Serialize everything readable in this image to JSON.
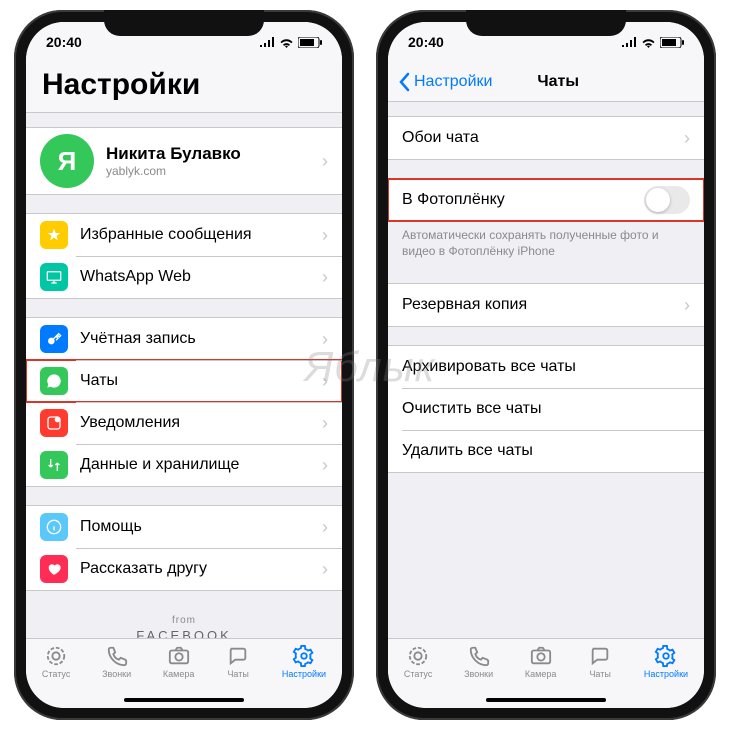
{
  "status": {
    "time": "20:40"
  },
  "left": {
    "title": "Настройки",
    "profile": {
      "initial": "Я",
      "name": "Никита Булавко",
      "sub": "yablyk.com"
    },
    "g1": [
      {
        "label": "Избранные сообщения"
      },
      {
        "label": "WhatsApp Web"
      }
    ],
    "g2": [
      {
        "label": "Учётная запись"
      },
      {
        "label": "Чаты"
      },
      {
        "label": "Уведомления"
      },
      {
        "label": "Данные и хранилище"
      }
    ],
    "g3": [
      {
        "label": "Помощь"
      },
      {
        "label": "Рассказать другу"
      }
    ],
    "from": {
      "small": "from",
      "brand": "FACEBOOK"
    }
  },
  "right": {
    "back": "Настройки",
    "title": "Чаты",
    "wallpaper": "Обои чата",
    "cameraRoll": "В Фотоплёнку",
    "cameraRollNote": "Автоматически сохранять полученные фото и видео в Фотоплёнку iPhone",
    "backup": "Резервная копия",
    "archive": "Архивировать все чаты",
    "clear": "Очистить все чаты",
    "delete": "Удалить все чаты"
  },
  "tabs": {
    "status": "Статус",
    "calls": "Звонки",
    "camera": "Камера",
    "chats": "Чаты",
    "settings": "Настройки"
  },
  "watermark": "Яблык"
}
